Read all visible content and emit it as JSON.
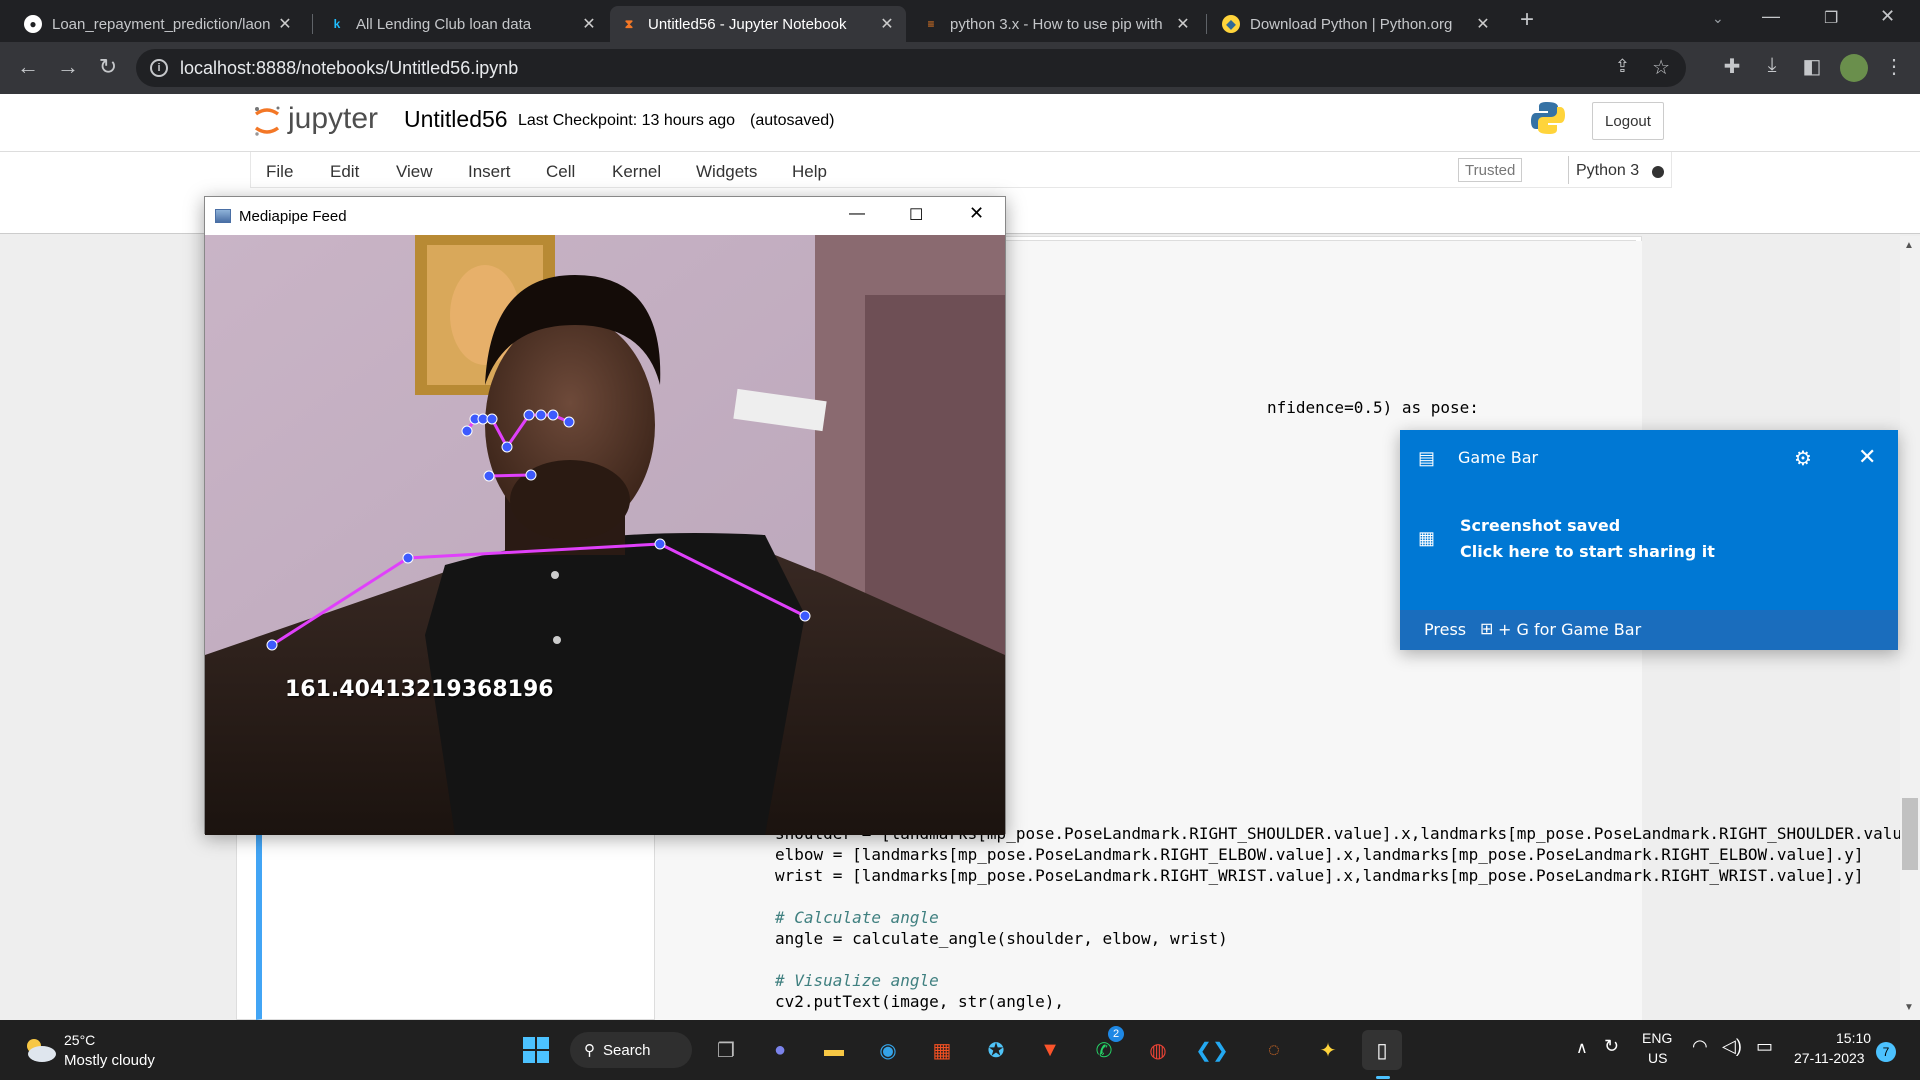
{
  "browser": {
    "tabs": [
      {
        "title": "Loan_repayment_prediction/laon",
        "favicon": "github-icon"
      },
      {
        "title": "All Lending Club loan data",
        "favicon": "kaggle-icon"
      },
      {
        "title": "Untitled56 - Jupyter Notebook",
        "favicon": "hourglass-icon",
        "active": true
      },
      {
        "title": "python 3.x - How to use pip with",
        "favicon": "stackoverflow-icon"
      },
      {
        "title": "Download Python | Python.org",
        "favicon": "python-icon"
      }
    ],
    "new_tab": "+",
    "url": "localhost:8888/notebooks/Untitled56.ipynb"
  },
  "jupyter": {
    "logo_text": "jupyter",
    "notebook_name": "Untitled56",
    "checkpoint": "Last Checkpoint: 13 hours ago",
    "autosave": "(autosaved)",
    "logout": "Logout",
    "menu": [
      "File",
      "Edit",
      "View",
      "Insert",
      "Cell",
      "Kernel",
      "Widgets",
      "Help"
    ],
    "trusted": "Trusted",
    "kernel": "Python 3"
  },
  "code": {
    "line_partial": "nfidence=0.5) as pose:",
    "line_shoulder": "shoulder = [landmarks[mp_pose.PoseLandmark.RIGHT_SHOULDER.value].x,landmarks[mp_pose.PoseLandmark.RIGHT_SHOULDER.valu",
    "line_elbow": "elbow = [landmarks[mp_pose.PoseLandmark.RIGHT_ELBOW.value].x,landmarks[mp_pose.PoseLandmark.RIGHT_ELBOW.value].y]",
    "line_wrist": "wrist = [landmarks[mp_pose.PoseLandmark.RIGHT_WRIST.value].x,landmarks[mp_pose.PoseLandmark.RIGHT_WRIST.value].y]",
    "comment_calc": "# Calculate angle",
    "line_angle": "angle = calculate_angle(shoulder, elbow, wrist)",
    "comment_vis": "# Visualize angle",
    "line_puttext": "cv2.putText(image, str(angle),"
  },
  "mediapipe": {
    "title": "Mediapipe Feed",
    "angle_label": "161.40413219368196"
  },
  "gamebar": {
    "title": "Game Bar",
    "notif_title": "Screenshot saved",
    "notif_sub": "Click here to start sharing it",
    "footer_pre": "Press",
    "footer_post": "+ G for Game Bar"
  },
  "taskbar": {
    "weather_temp": "25°C",
    "weather_desc": "Mostly cloudy",
    "search": "Search",
    "lang_1": "ENG",
    "lang_2": "US",
    "time": "15:10",
    "date": "27-11-2023",
    "notif_count": "7",
    "whatsapp_badge": "2"
  },
  "colors": {
    "accent_blue": "#0078d4",
    "cell_border": "#42a5f5",
    "pose_line": "#e040fb",
    "pose_point": "#3d5afe"
  }
}
